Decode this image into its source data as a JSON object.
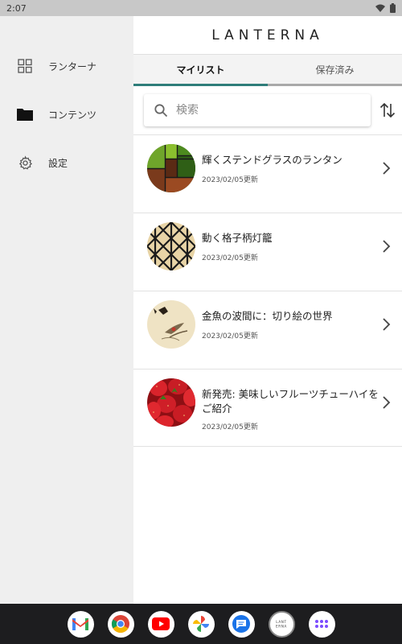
{
  "status_bar": {
    "time": "2:07"
  },
  "sidebar": {
    "items": [
      {
        "label": "ランターナ",
        "icon": "grid-icon"
      },
      {
        "label": "コンテンツ",
        "icon": "folder-icon"
      },
      {
        "label": "設定",
        "icon": "gear-icon"
      }
    ]
  },
  "app": {
    "title": "LANTERNA"
  },
  "tabs": [
    {
      "label": "マイリスト",
      "active": true
    },
    {
      "label": "保存済み",
      "active": false
    }
  ],
  "search": {
    "placeholder": "検索",
    "value": ""
  },
  "list": [
    {
      "title": "輝くステンドグラスのランタン",
      "date": "2023/02/05更新",
      "thumb": "stained-glass-thumbnail"
    },
    {
      "title": "動く格子柄灯籠",
      "date": "2023/02/05更新",
      "thumb": "lattice-lantern-thumbnail"
    },
    {
      "title": "金魚の波間に：切り絵の世界",
      "date": "2023/02/05更新",
      "thumb": "goldfish-papercut-thumbnail"
    },
    {
      "title": "新発売: 美味しいフルーツチューハイをご紹介",
      "date": "2023/02/05更新",
      "thumb": "strawberry-thumbnail"
    }
  ],
  "dock": {
    "apps": [
      "gmail-icon",
      "chrome-icon",
      "youtube-icon",
      "photos-icon",
      "messages-icon",
      "lanterna-app-icon",
      "app-drawer-icon"
    ],
    "lanterna_label": "LANTERNA"
  },
  "colors": {
    "tab_indicator": "#2f7d7a",
    "sidebar_bg": "#efefef",
    "dock_bg": "#1d1d1f"
  }
}
